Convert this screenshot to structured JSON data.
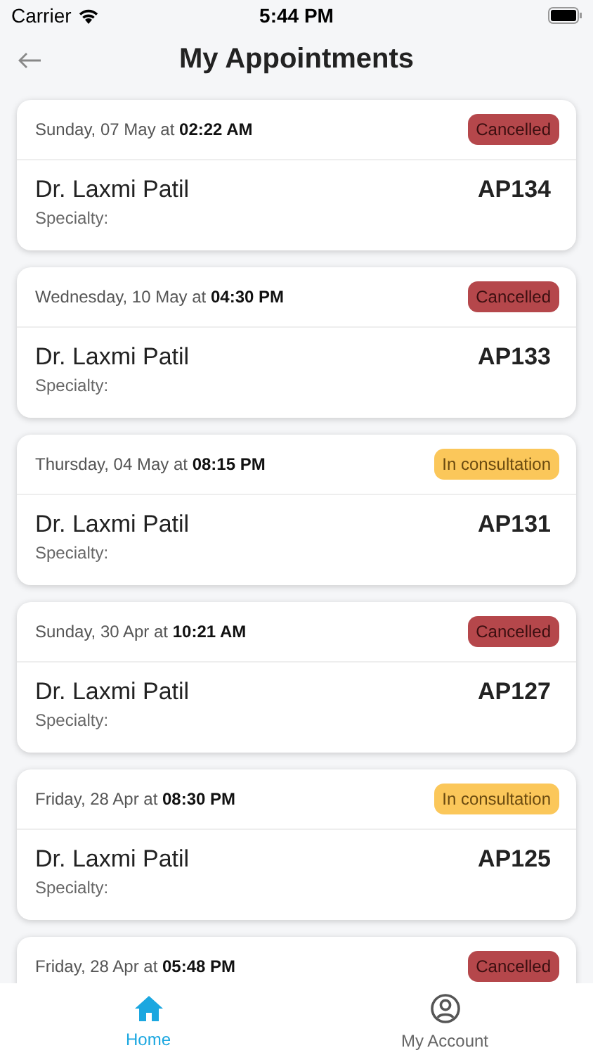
{
  "status_bar": {
    "carrier": "Carrier",
    "time": "5:44 PM"
  },
  "header": {
    "title": "My Appointments"
  },
  "appointments": [
    {
      "date": "Sunday, 07 May at **02:22 AM**",
      "status": "Cancelled",
      "kind": "cancelled",
      "doctor": "Dr. Laxmi Patil",
      "id": "AP134",
      "specialty": "Specialty:"
    },
    {
      "date": "Wednesday, 10 May at **04:30 PM**",
      "status": "Cancelled",
      "kind": "cancelled",
      "doctor": "Dr. Laxmi Patil",
      "id": "AP133",
      "specialty": "Specialty:"
    },
    {
      "date": "Thursday, 04 May at **08:15 PM**",
      "status": "In consultation",
      "kind": "consultation",
      "doctor": "Dr. Laxmi Patil",
      "id": "AP131",
      "specialty": "Specialty:"
    },
    {
      "date": "Sunday, 30 Apr at **10:21 AM**",
      "status": "Cancelled",
      "kind": "cancelled",
      "doctor": "Dr. Laxmi Patil",
      "id": "AP127",
      "specialty": "Specialty:"
    },
    {
      "date": "Friday, 28 Apr at **08:30 PM**",
      "status": "In consultation",
      "kind": "consultation",
      "doctor": "Dr. Laxmi Patil",
      "id": "AP125",
      "specialty": "Specialty:"
    },
    {
      "date": "Friday, 28 Apr at **05:48 PM**",
      "status": "Cancelled",
      "kind": "cancelled"
    }
  ],
  "tab_bar": [
    {
      "label": "Home",
      "kind": "home",
      "selected": true
    },
    {
      "label": "My Account",
      "kind": "account",
      "selected": false
    }
  ]
}
